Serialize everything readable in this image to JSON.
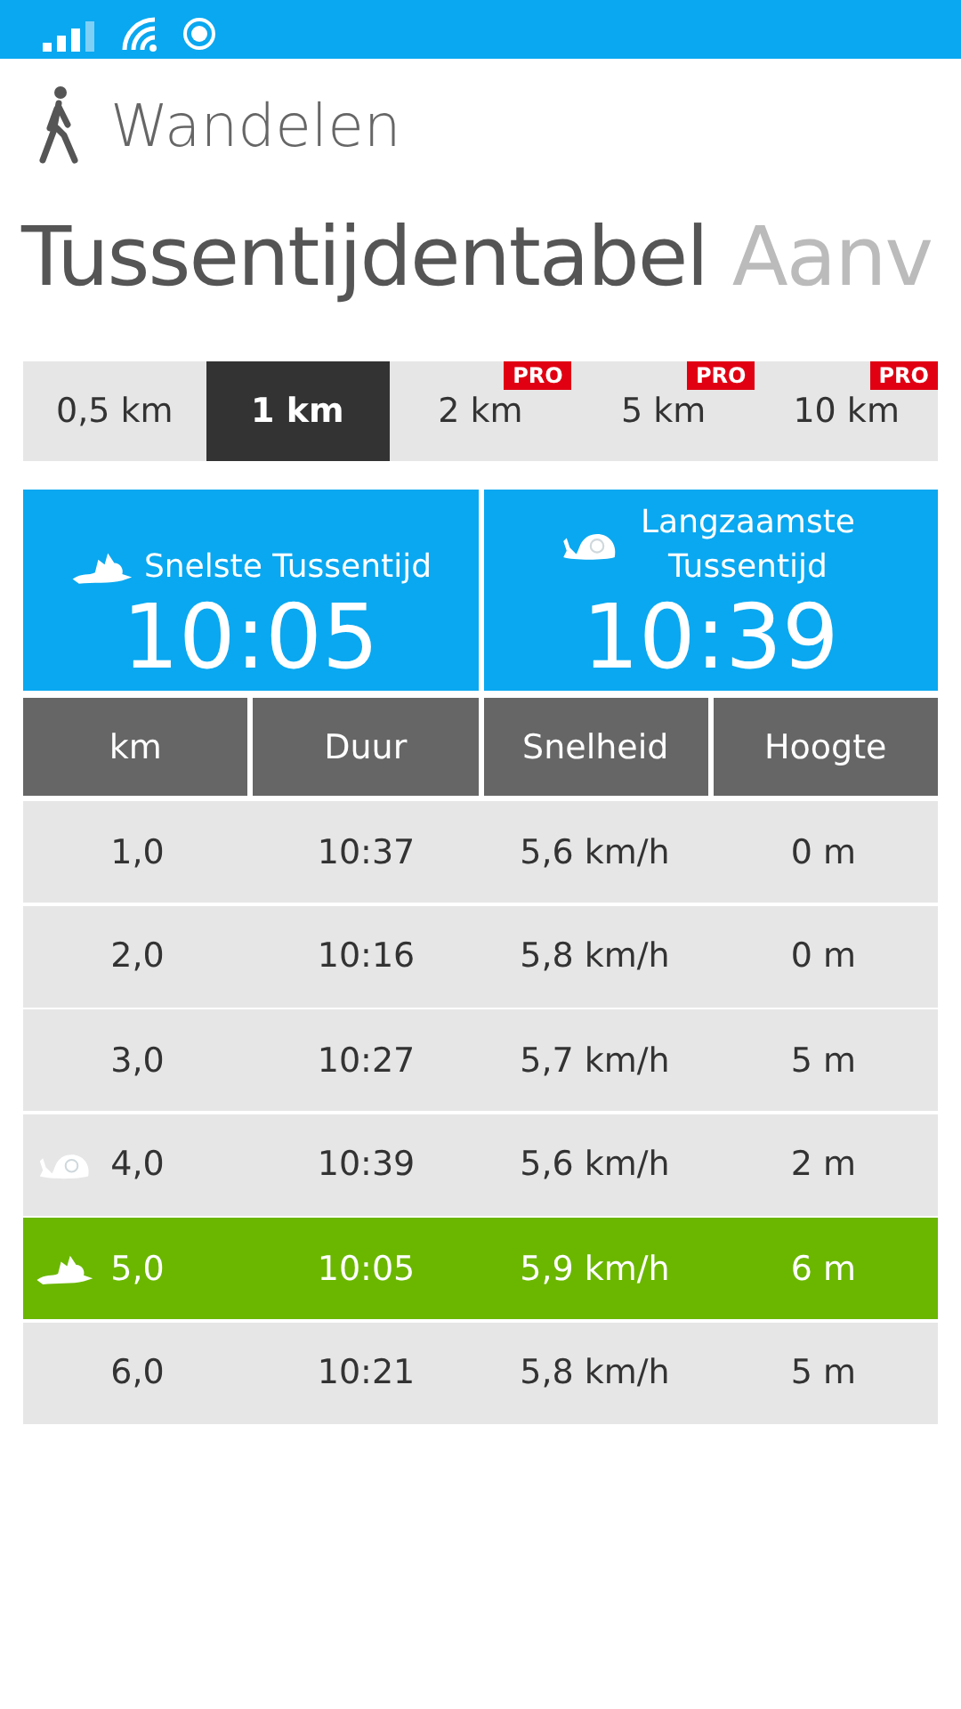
{
  "app": {
    "title": "Wandelen"
  },
  "pivot": [
    {
      "label": "Tussentijdentabel",
      "selected": true
    },
    {
      "label": "Aanv",
      "selected": false
    }
  ],
  "tabs": [
    {
      "label": "0,5 km",
      "selected": false,
      "pro": false
    },
    {
      "label": "1 km",
      "selected": true,
      "pro": false
    },
    {
      "label": "2 km",
      "selected": false,
      "pro": true,
      "badge": "PRO"
    },
    {
      "label": "5 km",
      "selected": false,
      "pro": true,
      "badge": "PRO"
    },
    {
      "label": "10 km",
      "selected": false,
      "pro": true,
      "badge": "PRO"
    }
  ],
  "summary": [
    {
      "kind": "fastest",
      "label": "Snelste Tussentijd",
      "value": "10:05"
    },
    {
      "kind": "slowest",
      "label": "Langzaamste Tussentijd",
      "value": "10:39"
    }
  ],
  "table": {
    "columns": [
      "km",
      "Duur",
      "Snelheid",
      "Hoogte"
    ],
    "rows": [
      {
        "kind": "normal",
        "cells": [
          "1,0",
          "10:37",
          "5,6 km/h",
          "0 m"
        ]
      },
      {
        "kind": "normal",
        "cells": [
          "2,0",
          "10:16",
          "5,8 km/h",
          "0 m"
        ]
      },
      {
        "kind": "normal",
        "cells": [
          "3,0",
          "10:27",
          "5,7 km/h",
          "5 m"
        ]
      },
      {
        "kind": "slowest",
        "cells": [
          "4,0",
          "10:39",
          "5,6 km/h",
          "2 m"
        ]
      },
      {
        "kind": "fastest",
        "cells": [
          "5,0",
          "10:05",
          "5,9 km/h",
          "6 m"
        ]
      },
      {
        "kind": "normal",
        "cells": [
          "6,0",
          "10:21",
          "5,8 km/h",
          "5 m"
        ]
      }
    ]
  }
}
